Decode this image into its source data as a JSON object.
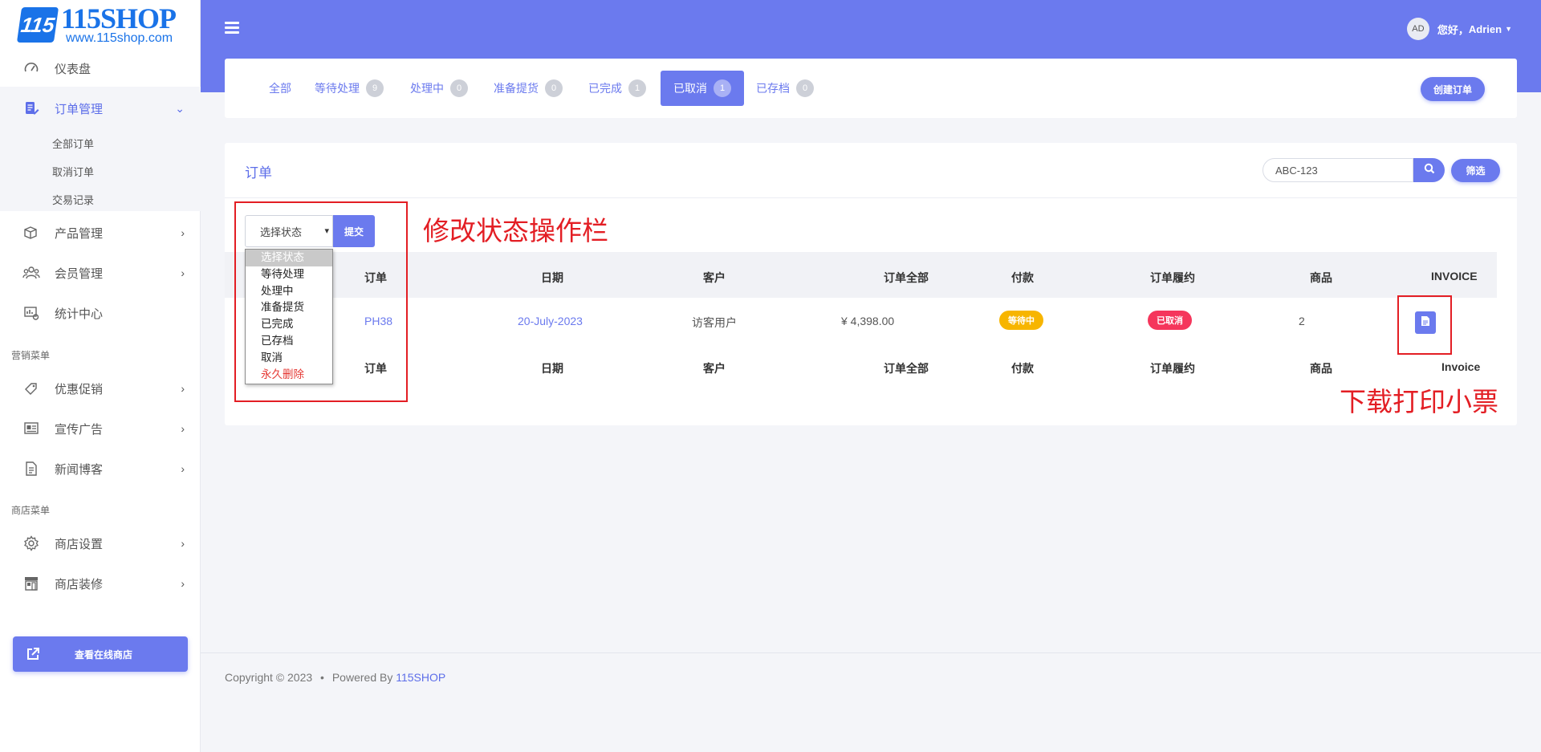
{
  "logo": {
    "mark": "115",
    "name": "115SHOP",
    "url": "www.115shop.com"
  },
  "sidebar": {
    "items": [
      {
        "label": "仪表盘",
        "icon": "dashboard-icon"
      },
      {
        "label": "订单管理",
        "icon": "order-icon"
      },
      {
        "label": "产品管理",
        "icon": "product-icon"
      },
      {
        "label": "会员管理",
        "icon": "members-icon"
      },
      {
        "label": "统计中心",
        "icon": "statistics-icon"
      },
      {
        "label": "优惠促销",
        "icon": "promotion-icon"
      },
      {
        "label": "宣传广告",
        "icon": "advert-icon"
      },
      {
        "label": "新闻博客",
        "icon": "blog-icon"
      },
      {
        "label": "商店设置",
        "icon": "gear-icon"
      },
      {
        "label": "商店装修",
        "icon": "storefront-icon"
      }
    ],
    "sub_items": [
      "全部订单",
      "取消订单",
      "交易记录"
    ],
    "section_marketing": "营销菜单",
    "section_store": "商店菜单",
    "store_button": "查看在线商店"
  },
  "header": {
    "avatar": "AD",
    "greeting": "您好，",
    "username": "Adrien"
  },
  "tabs": [
    {
      "label": "全部",
      "count": null
    },
    {
      "label": "等待处理",
      "count": "9"
    },
    {
      "label": "处理中",
      "count": "0"
    },
    {
      "label": "准备提货",
      "count": "0"
    },
    {
      "label": "已完成",
      "count": "1"
    },
    {
      "label": "已取消",
      "count": "1"
    },
    {
      "label": "已存档",
      "count": "0"
    }
  ],
  "create_order": "创建订单",
  "orders": {
    "title": "订单",
    "search_value": "ABC-123",
    "filter_label": "筛选",
    "status_select": "选择状态",
    "submit_label": "提交",
    "status_options": [
      "选择状态",
      "等待处理",
      "处理中",
      "准备提货",
      "已完成",
      "已存档",
      "取消",
      "永久删除"
    ],
    "columns": [
      "订单",
      "日期",
      "客户",
      "订单全部",
      "付款",
      "订单履约",
      "商品",
      "INVOICE"
    ],
    "footer_columns": [
      "订单",
      "日期",
      "客户",
      "订单全部",
      "付款",
      "订单履约",
      "商品",
      "Invoice"
    ],
    "rows": [
      {
        "order": "PH38",
        "date": "20-July-2023",
        "customer": "访客用户",
        "total": "¥ 4,398.00",
        "payment": "等待中",
        "fulfillment": "已取消",
        "items": "2"
      }
    ]
  },
  "annotations": {
    "status_bar": "修改状态操作栏",
    "download_receipt": "下载打印小票"
  },
  "footer": {
    "copyright": "Copyright © 2023",
    "dot": "•",
    "powered": "Powered By",
    "brand": "115SHOP"
  },
  "colors": {
    "accent": "#6b7aee",
    "payment_pending": "#f7b500",
    "fulfillment_cancelled": "#f5365c",
    "annotation": "#e31e24"
  }
}
